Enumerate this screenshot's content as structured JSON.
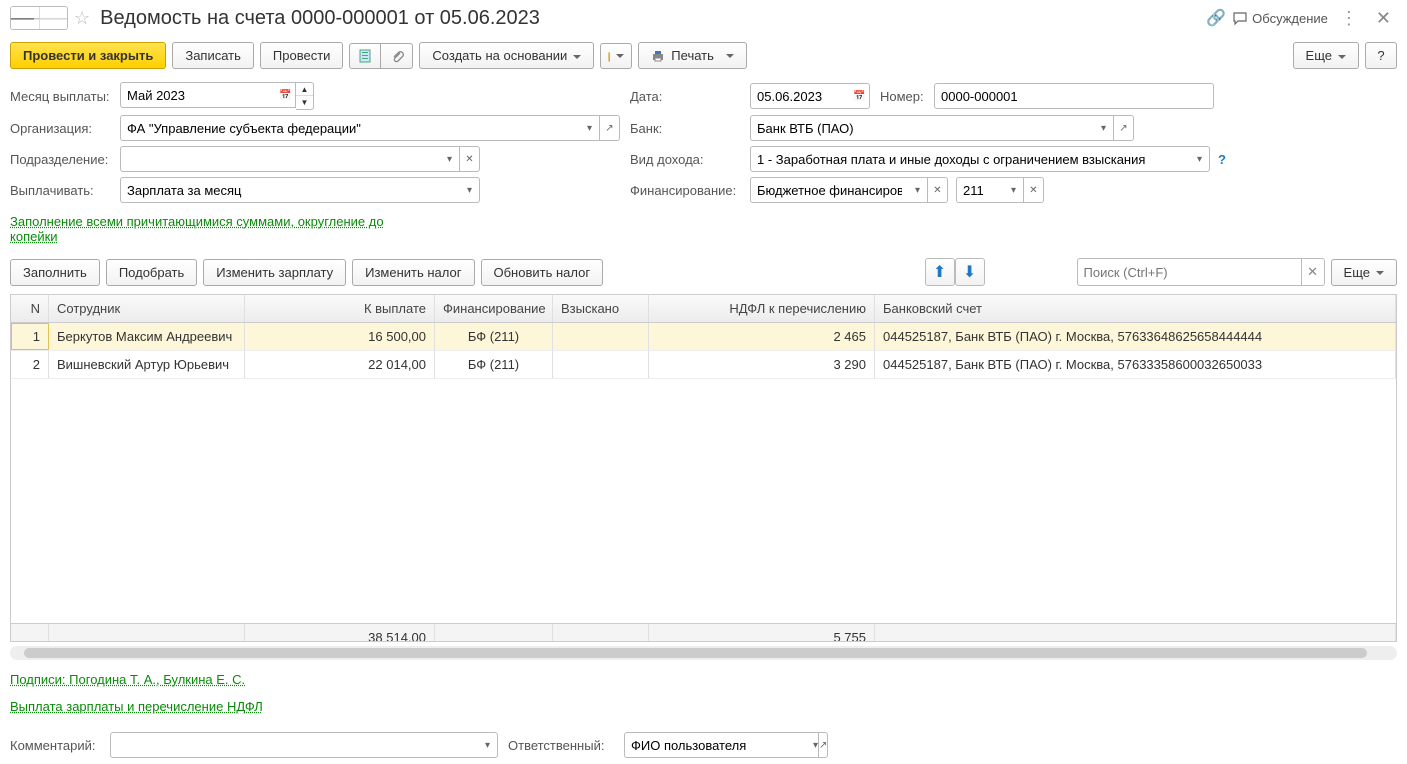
{
  "title": "Ведомость на счета 0000-000001 от 05.06.2023",
  "header": {
    "discuss": "Обсуждение"
  },
  "toolbar": {
    "post_close": "Провести и закрыть",
    "save": "Записать",
    "post": "Провести",
    "create_from": "Создать на основании",
    "print": "Печать",
    "more": "Еще"
  },
  "form": {
    "month_label": "Месяц выплаты:",
    "month": "Май 2023",
    "date_label": "Дата:",
    "date": "05.06.2023",
    "number_label": "Номер:",
    "number": "0000-000001",
    "org_label": "Организация:",
    "org": "ФА \"Управление субъекта федерации\"",
    "bank_label": "Банк:",
    "bank": "Банк ВТБ (ПАО)",
    "dept_label": "Подразделение:",
    "dept": "",
    "income_label": "Вид дохода:",
    "income": "1 - Заработная плата и иные доходы с ограничением взыскания",
    "pay_label": "Выплачивать:",
    "pay": "Зарплата за месяц",
    "fin_label": "Финансирование:",
    "fin": "Бюджетное финансирова",
    "fin_code": "211",
    "fill_link": "Заполнение всеми причитающимися суммами, округление до копейки"
  },
  "actions": {
    "fill": "Заполнить",
    "pick": "Подобрать",
    "edit_salary": "Изменить зарплату",
    "edit_tax": "Изменить налог",
    "update_tax": "Обновить налог",
    "search_ph": "Поиск (Ctrl+F)",
    "more": "Еще"
  },
  "table": {
    "cols": {
      "n": "N",
      "emp": "Сотрудник",
      "pay": "К выплате",
      "fin": "Финансирование",
      "col": "Взыскано",
      "tax": "НДФЛ к перечислению",
      "bank": "Банковский счет"
    },
    "rows": [
      {
        "n": "1",
        "emp": "Беркутов Максим Андреевич",
        "pay": "16 500,00",
        "fin": "БФ (211)",
        "col": "",
        "tax": "2 465",
        "bank": "044525187, Банк ВТБ (ПАО) г. Москва, 57633648625658444444"
      },
      {
        "n": "2",
        "emp": "Вишневский Артур Юрьевич",
        "pay": "22 014,00",
        "fin": "БФ (211)",
        "col": "",
        "tax": "3 290",
        "bank": "044525187, Банк ВТБ (ПАО) г. Москва, 57633358600032650033"
      }
    ],
    "totals": {
      "pay": "38 514,00",
      "tax": "5 755"
    }
  },
  "bottom": {
    "sign_link": "Подписи: Погодина Т. А., Булкина Е. С.",
    "pay_link": "Выплата зарплаты и перечисление НДФЛ",
    "comment_label": "Комментарий:",
    "comment": "",
    "resp_label": "Ответственный:",
    "resp": "ФИО пользователя"
  }
}
